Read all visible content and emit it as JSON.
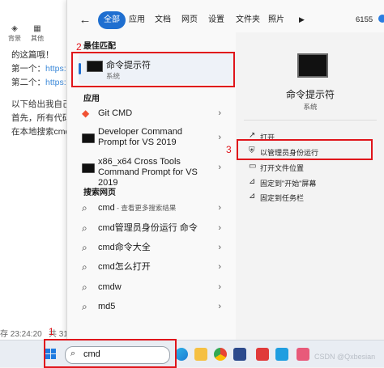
{
  "background_page": {
    "toolbar": [
      {
        "label": "背景",
        "icon": "paint-bucket-icon"
      },
      {
        "label": "其他",
        "icon": "grid-icon"
      }
    ],
    "lines": [
      {
        "text": "的这篇哦！"
      },
      {
        "text": "第一个：",
        "link": "https:"
      },
      {
        "text": "第二个：",
        "link": "https:"
      },
      {
        "text": "以下给出我自己"
      },
      {
        "text": "首先，所有代码"
      },
      {
        "text": "在本地搜索cmd"
      }
    ],
    "footer_left": "存 23:24:20",
    "footer_right": "共 31",
    "footer_above": "1"
  },
  "menu": {
    "filters": [
      "全部",
      "应用",
      "文档",
      "网页",
      "设置",
      "文件夹",
      "照片"
    ],
    "active_filter": "全部",
    "score": "6155",
    "best_match": {
      "section": "最佳匹配",
      "title": "命令提示符",
      "subtitle": "系统"
    },
    "apps_section": "应用",
    "apps": [
      {
        "title": "Git CMD",
        "icon": "git-icon"
      },
      {
        "title": "Developer Command Prompt for VS 2019",
        "icon": "terminal-icon"
      },
      {
        "title": "x86_x64 Cross Tools Command Prompt for VS 2019",
        "icon": "terminal-icon"
      }
    ],
    "web_section": "搜索网页",
    "web_results": [
      {
        "title": "cmd",
        "suffix": " - 查看更多搜索结果"
      },
      {
        "title": "cmd管理员身份运行 命令"
      },
      {
        "title": "cmd命令大全"
      },
      {
        "title": "cmd怎么打开"
      },
      {
        "title": "cmdw"
      },
      {
        "title": "md5"
      }
    ],
    "detail": {
      "title": "命令提示符",
      "subtitle": "系统",
      "actions": [
        {
          "label": "打开",
          "icon": "open-icon"
        },
        {
          "label": "以管理员身份运行",
          "icon": "admin-shield-icon"
        },
        {
          "label": "打开文件位置",
          "icon": "folder-icon"
        },
        {
          "label": "固定到\"开始\"屏幕",
          "icon": "pin-icon"
        },
        {
          "label": "固定到任务栏",
          "icon": "pin-icon"
        }
      ]
    }
  },
  "annotations": {
    "step1": "1",
    "step2": "2",
    "step3": "3"
  },
  "taskbar": {
    "search_value": "cmd",
    "watermark": "CSDN @Qxbesian"
  },
  "colors": {
    "accent": "#1f6fd0",
    "annotation_red": "#e0151b"
  }
}
